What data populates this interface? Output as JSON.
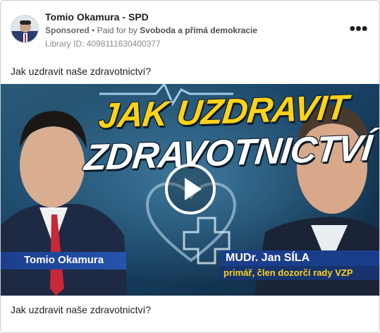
{
  "ad": {
    "advertiser_name": "Tomio Okamura - SPD",
    "sponsored_label": "Sponsored",
    "separator": "•",
    "paid_for_prefix": "Paid for by",
    "payer_name": "Svoboda a přímá demokracie",
    "library_id": "Library ID: 4098111630400377",
    "more_icon": "more-dots-icon",
    "body_text": "Jak uzdravit naše zdravotnictví?",
    "caption": "Jak uzdravit naše zdravotnictví?"
  },
  "video": {
    "headline_line1": "JAK UZDRAVIT",
    "headline_line2": "ZDRAVOTNICTVÍ",
    "left_name": "Tomio Okamura",
    "right_name": "MUDr. Jan SÍLA",
    "right_role": "primář, člen dozorčí rady VZP",
    "play_icon": "play-icon",
    "colors": {
      "headline_yellow": "#ffd21a",
      "name_bar_blue": "#1b3e8c",
      "background": "#1a3650"
    }
  }
}
